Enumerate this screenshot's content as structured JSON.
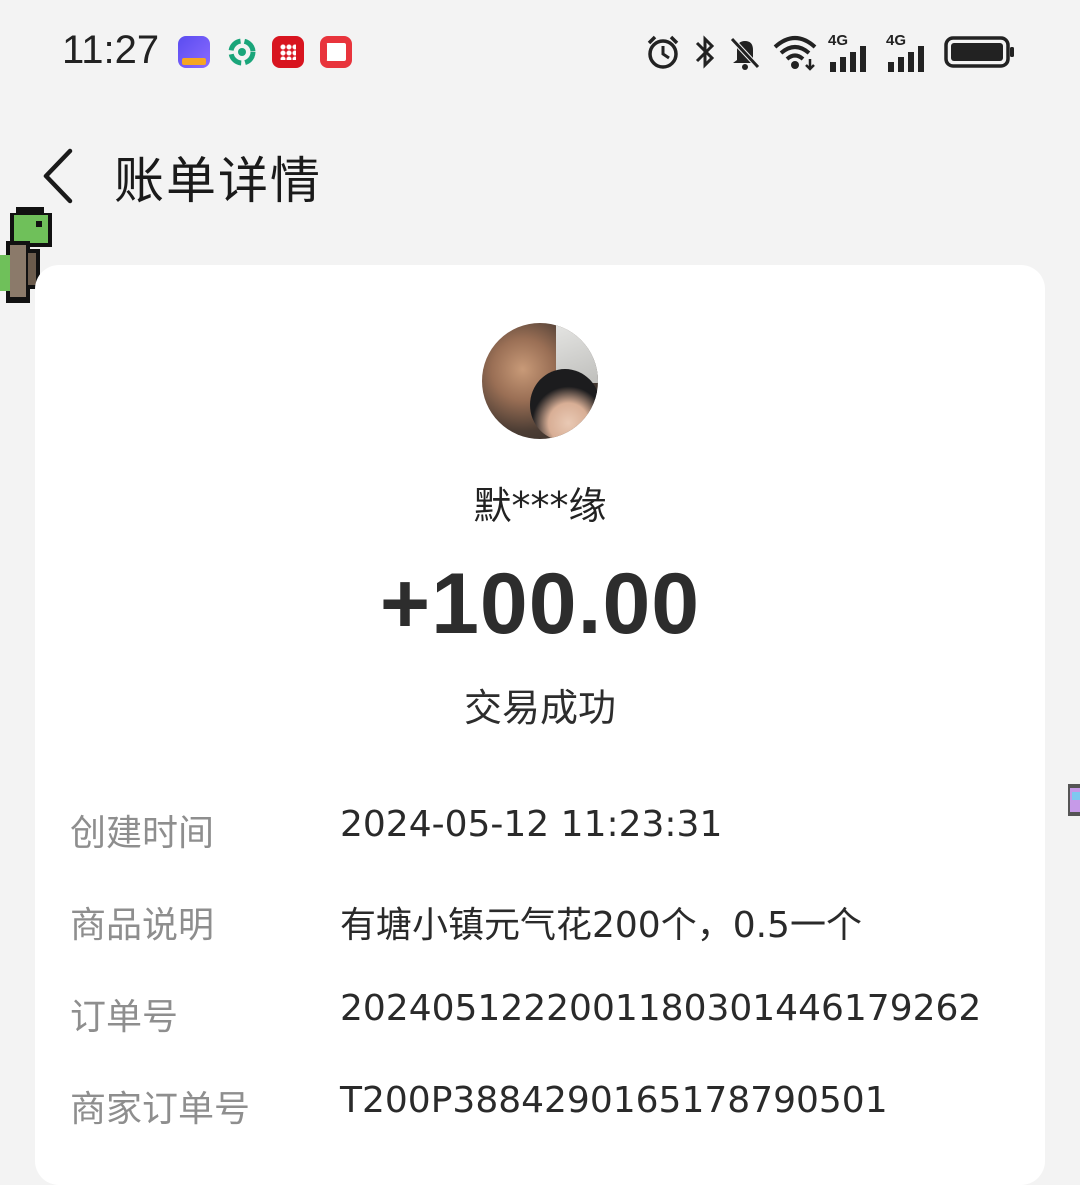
{
  "status_bar": {
    "time": "11:27",
    "app_icons": [
      "game-app-icon",
      "circle-app-icon",
      "red-dots-app-icon",
      "reader-app-icon"
    ],
    "system_icons": [
      "alarm-icon",
      "bluetooth-icon",
      "mute-icon",
      "wifi-icon",
      "signal-4g-1-icon",
      "signal-4g-2-icon",
      "battery-icon"
    ],
    "network_label_1": "4G",
    "network_label_2": "4G"
  },
  "header": {
    "title": "账单详情",
    "back_icon": "chevron-left-icon"
  },
  "transaction": {
    "payer_name": "默***缘",
    "amount": "+100.00",
    "status": "交易成功"
  },
  "details": [
    {
      "label": "创建时间",
      "value": "2024-05-12 11:23:31"
    },
    {
      "label": "商品说明",
      "value": "有塘小镇元气花200个，0.5一个"
    },
    {
      "label": "订单号",
      "value": "2024051222001180301446179262"
    },
    {
      "label": "商家订单号",
      "value": "T200P3884290165178790501"
    }
  ],
  "colors": {
    "background": "#f3f3f3",
    "card": "#ffffff",
    "label": "#8e8e8e",
    "value": "#2a2a2a"
  }
}
